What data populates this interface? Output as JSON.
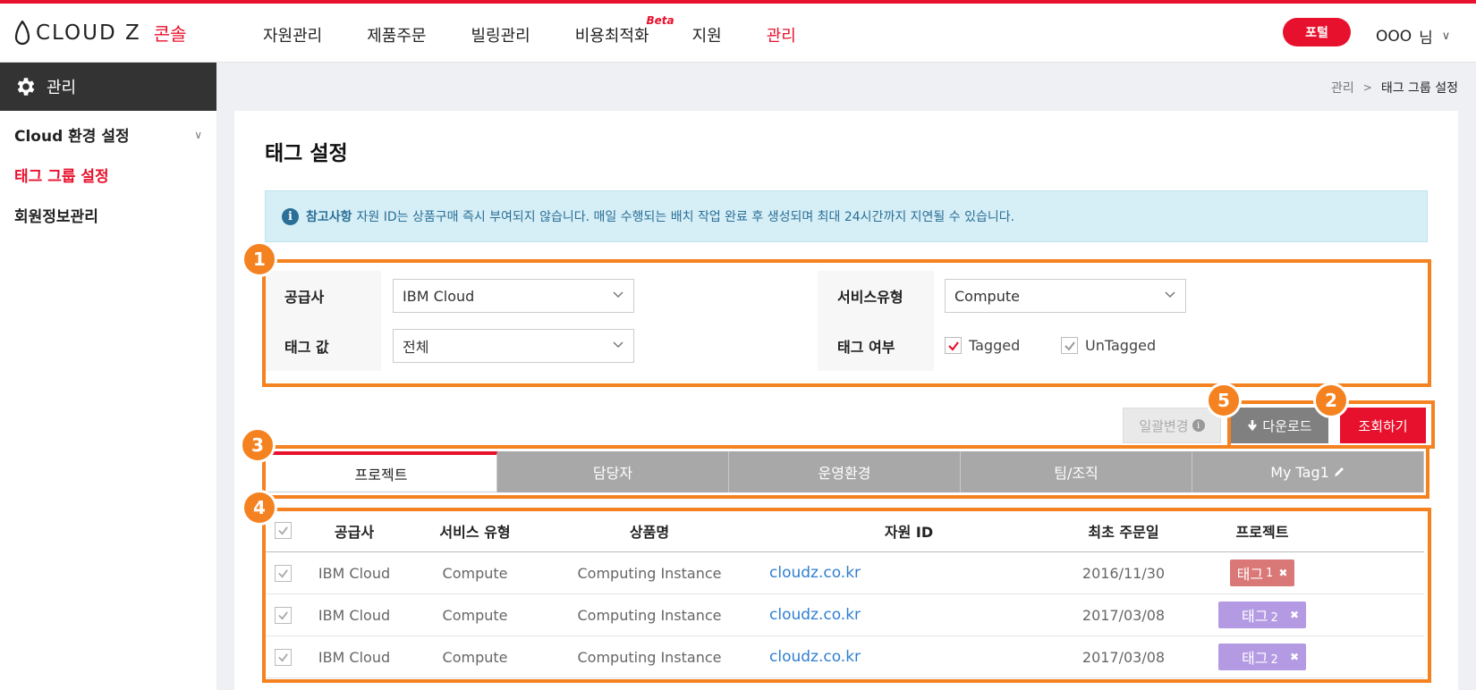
{
  "brand": {
    "name": "CLOUD Z",
    "sub": "콘솔"
  },
  "gnb": [
    {
      "label": "자원관리"
    },
    {
      "label": "제품주문"
    },
    {
      "label": "빌링관리"
    },
    {
      "label": "비용최적화",
      "badge": "Beta"
    },
    {
      "label": "지원"
    },
    {
      "label": "관리"
    }
  ],
  "header": {
    "portal_label": "포털",
    "user_name": "OOO",
    "user_suffix": "님"
  },
  "sidebar": {
    "title": "관리",
    "items": [
      {
        "label": "Cloud 환경 설정"
      },
      {
        "label": "태그 그룹 설정"
      },
      {
        "label": "회원정보관리"
      }
    ]
  },
  "breadcrumb": {
    "parent": "관리",
    "current": "태그 그룹 설정"
  },
  "page": {
    "title": "태그 설정",
    "notice_strong": "참고사항",
    "notice_text": "자원 ID는 상품구매 즉시 부여되지 않습니다. 매일 수행되는 배치 작업 완료 후 생성되며 최대 24시간까지 지연될 수 있습니다."
  },
  "filter": {
    "vendor_label": "공급사",
    "vendor_value": "IBM Cloud",
    "service_label": "서비스유형",
    "service_value": "Compute",
    "tagvalue_label": "태그 값",
    "tagvalue_value": "전체",
    "tagged_label": "태그 여부",
    "tagged_option": "Tagged",
    "untagged_option": "UnTagged"
  },
  "actions": {
    "bulk_label": "일괄변경",
    "download_label": "다운로드",
    "search_label": "조회하기"
  },
  "tabs": [
    {
      "label": "프로젝트"
    },
    {
      "label": "담당자"
    },
    {
      "label": "운영환경"
    },
    {
      "label": "팀/조직"
    },
    {
      "label": "My Tag1"
    }
  ],
  "table": {
    "headers": [
      "공급사",
      "서비스 유형",
      "상품명",
      "자원 ID",
      "최초 주문일",
      "프로젝트"
    ],
    "rows": [
      {
        "vendor": "IBM Cloud",
        "service": "Compute",
        "product": "Computing Instance",
        "resource_id": "cloudz.co.kr",
        "date": "2016/11/30",
        "tag_base": "태그",
        "tag_num": "1"
      },
      {
        "vendor": "IBM Cloud",
        "service": "Compute",
        "product": "Computing Instance",
        "resource_id": "cloudz.co.kr",
        "date": "2017/03/08",
        "tag_base": "태그",
        "tag_num": "2"
      },
      {
        "vendor": "IBM Cloud",
        "service": "Compute",
        "product": "Computing Instance",
        "resource_id": "cloudz.co.kr",
        "date": "2017/03/08",
        "tag_base": "태그",
        "tag_num": "2"
      }
    ]
  },
  "annotations": [
    "1",
    "2",
    "3",
    "4",
    "5"
  ],
  "colors": {
    "brand_red": "#e8112d",
    "annotation_orange": "#f58220",
    "tag_red": "#da7777",
    "tag_purple": "#b49ae3",
    "link_blue": "#2f7fd1"
  }
}
